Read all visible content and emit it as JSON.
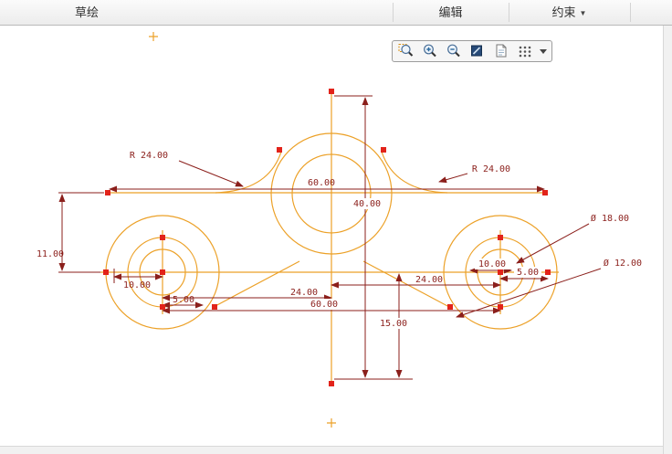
{
  "ribbon": {
    "tabs": [
      {
        "id": "sketch",
        "label": "草绘"
      },
      {
        "id": "edit",
        "label": "编辑"
      },
      {
        "id": "constrain",
        "label": "约束"
      }
    ],
    "dropdown_glyph": "▼"
  },
  "view_toolbar": {
    "buttons": [
      {
        "name": "zoom-window"
      },
      {
        "name": "zoom-in"
      },
      {
        "name": "zoom-out"
      },
      {
        "name": "repaint"
      },
      {
        "name": "saved-view-list"
      },
      {
        "name": "display-filters"
      }
    ]
  },
  "sketch": {
    "colors": {
      "geometry": "#eca128",
      "dimension": "#8b1f1b",
      "handle": "#e2231a"
    },
    "dimensions": {
      "fillet_left": "R 24.00",
      "fillet_right": "R 24.00",
      "top_width": "60.00",
      "center_height": "40.00",
      "left_offset": "11.00",
      "left_hole_width": "10.00",
      "left_hole_offset": "5.00",
      "left_center_distance": "24.00",
      "right_center_distance": "24.00",
      "bottom_width": "60.00",
      "bottom_depth": "15.00",
      "hole_outer_diameter": "Ø 18.00",
      "hole_inner_diameter": "Ø 12.00",
      "right_hole_width": "10.00",
      "right_hole_offset": "5.00"
    }
  }
}
